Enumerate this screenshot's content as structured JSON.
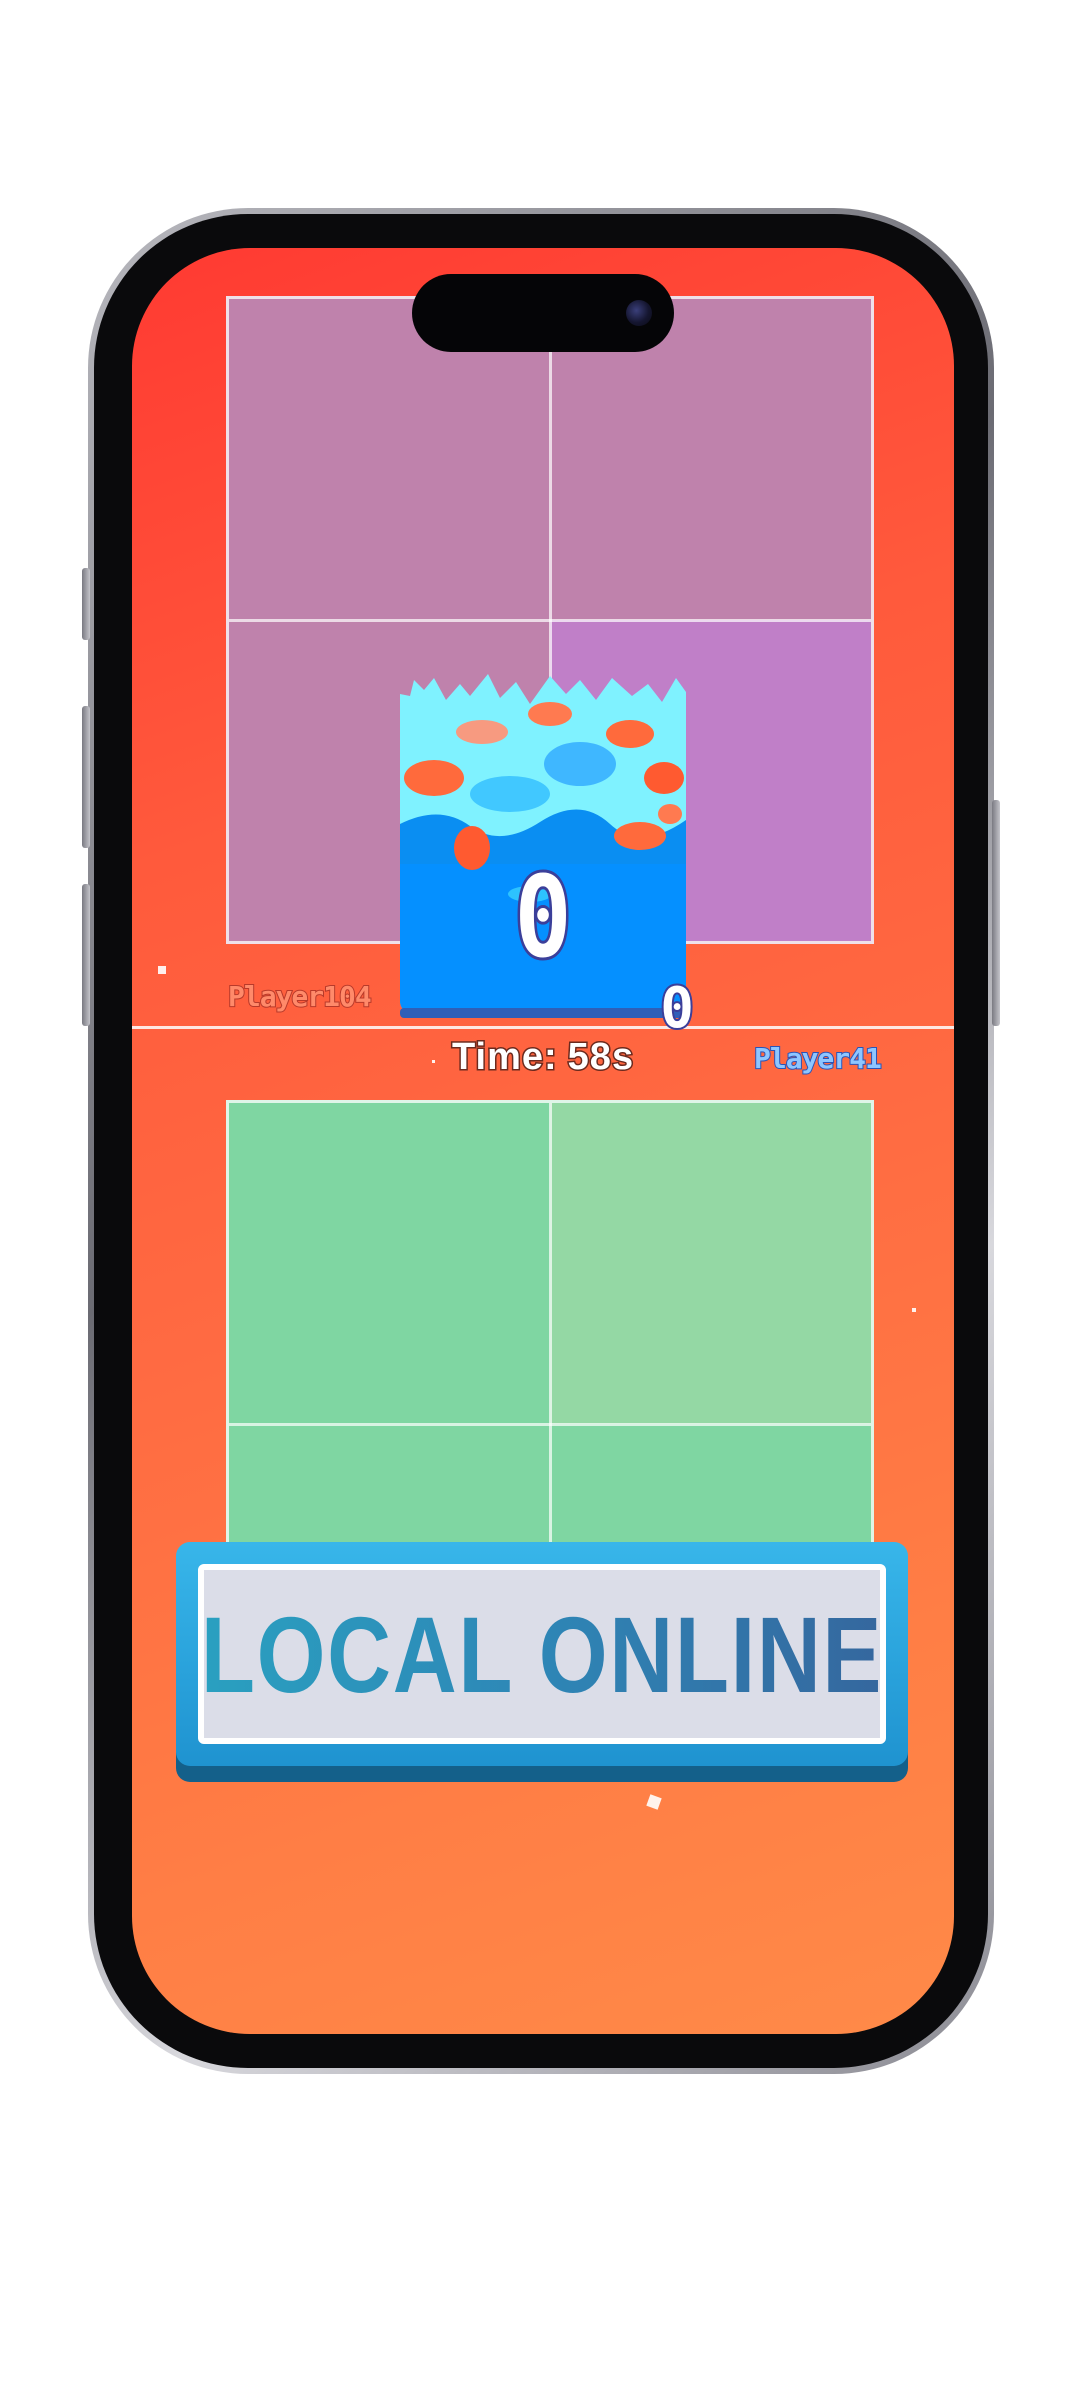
{
  "game": {
    "score_main": "0",
    "score_small": "0",
    "players": {
      "top": "Player104",
      "bottom": "Player41"
    },
    "timer": {
      "label": "Time:",
      "value": "58s"
    }
  },
  "menu": {
    "primary_label": "LOCAL ONLINE"
  },
  "colors": {
    "background_top": "#ff3a32",
    "background_bottom": "#ff8a48",
    "court_top": "#bf82ac",
    "court_bottom": "#7fd6a2",
    "button_frame": "#1f93d0",
    "button_face": "#dbdde8",
    "player_top": "#ff8a6a",
    "player_bottom": "#8ec6ff"
  }
}
